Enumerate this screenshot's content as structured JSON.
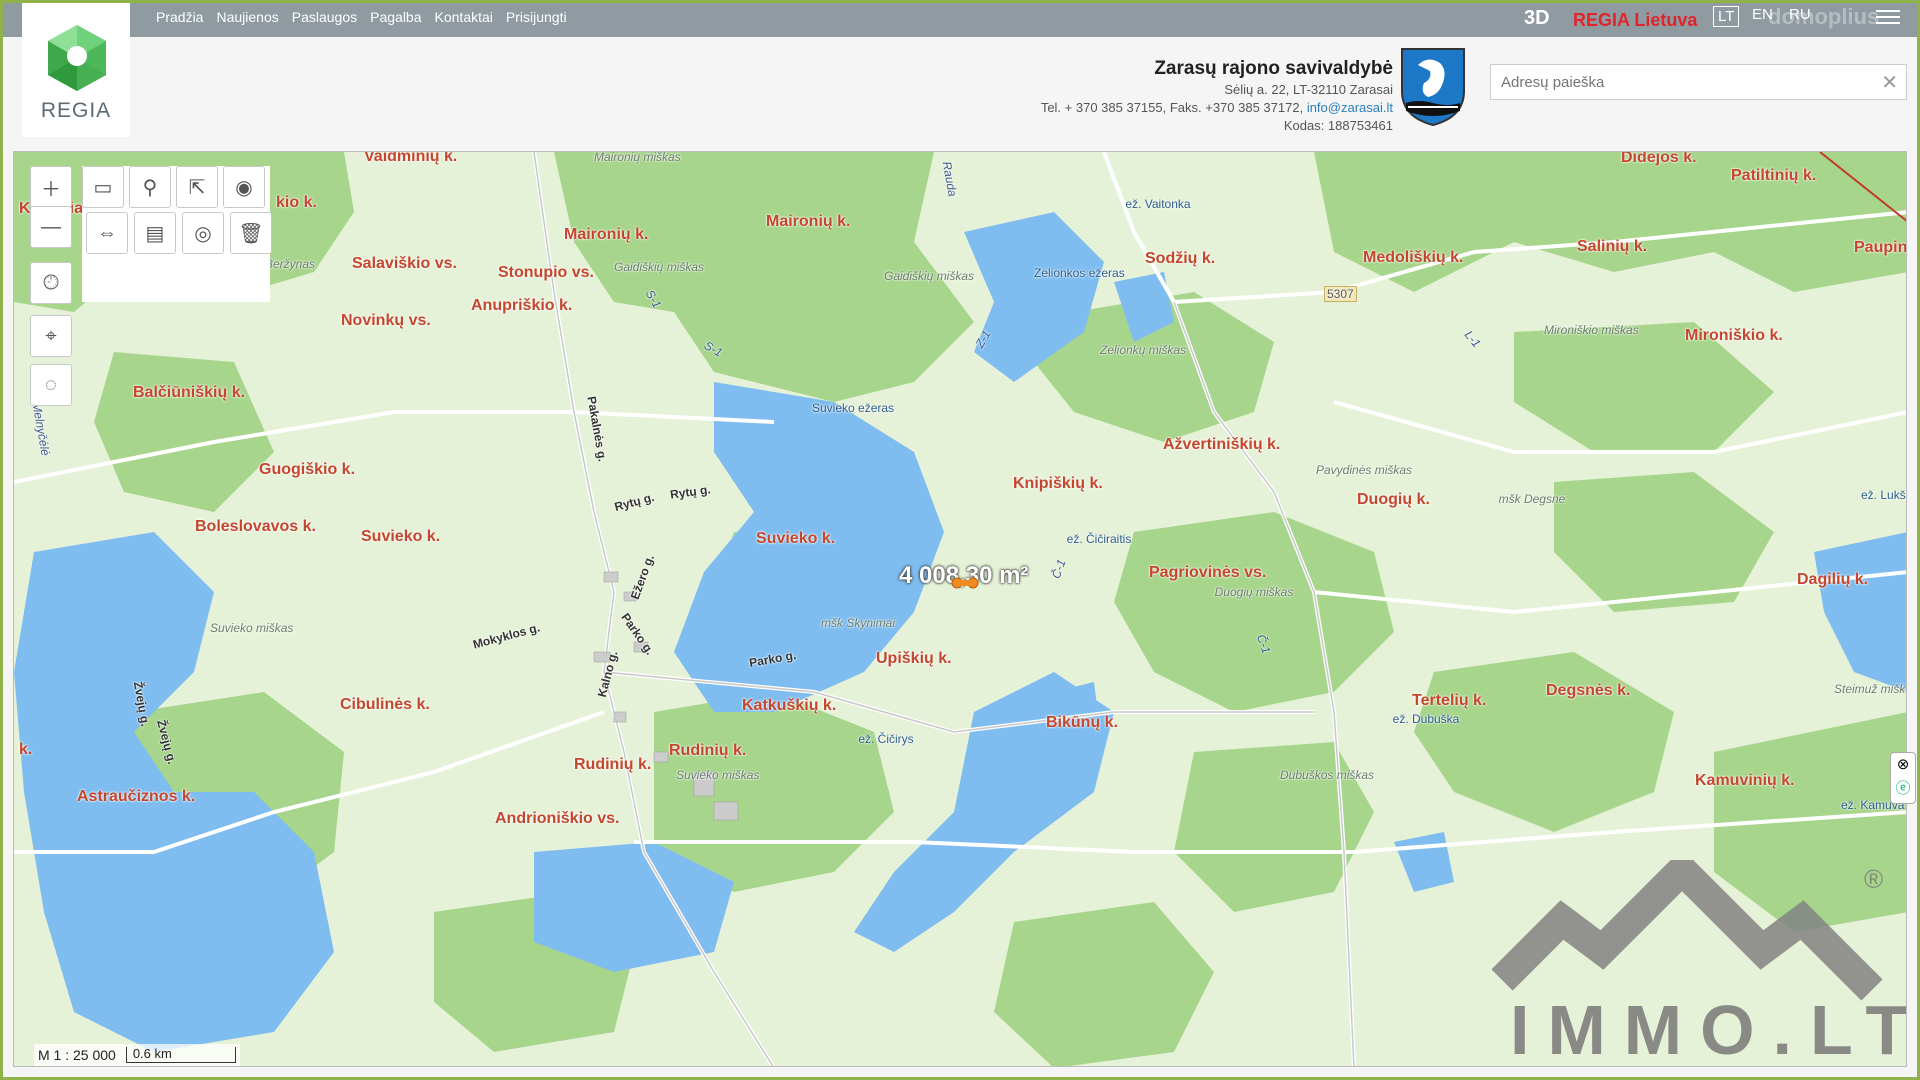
{
  "nav": {
    "items": [
      "Pradžia",
      "Naujienos",
      "Paslaugos",
      "Pagalba",
      "Kontaktai",
      "Prisijungti"
    ],
    "btn_3d": "3D",
    "regia_lietuva": "REGIA Lietuva",
    "lang_lt": "LT",
    "lang_en": "EN",
    "lang_ru": "RU",
    "watermark": "domoplius"
  },
  "logo": {
    "text": "REGIA"
  },
  "org": {
    "name": "Zarasų rajono savivaldybė",
    "address": "Sėlių a. 22, LT-32110 Zarasai",
    "phone": "Tel. + 370 385 37155, Faks. +370 385 37172, ",
    "email": "info@zarasai.lt",
    "code": "Kodas: 188753461"
  },
  "search": {
    "placeholder": "Adresų paieška"
  },
  "map": {
    "area_measurement": "4 008,30 m²",
    "scale_ratio": "M 1 : 25 000",
    "scale_bar": "0.6 km",
    "villages": [
      "Vaidminių k.",
      "Kroviniai",
      "kio k.",
      "Maironių k.",
      "Maironių k.",
      "Didėjos k.",
      "Patiltinių k.",
      "Salaviškio vs.",
      "Stonupio vs.",
      "Anupriškio k.",
      "Novinkų vs.",
      "Sodžių k.",
      "Medoliškių k.",
      "Salinių k.",
      "Paupin",
      "Mironiškio k.",
      "Balčiūniškių k.",
      "Ažvertiniškių k.",
      "Guogiškio k.",
      "Knipiškių k.",
      "Duogių k.",
      "Boleslovavos k.",
      "Suvieko k.",
      "Suvieko k.",
      "Pagriovinės vs.",
      "Dagilių k.",
      "Upiškių k.",
      "Cibulinės k.",
      "Katkuškių k.",
      "Tertelių k.",
      "Degsnės k.",
      "Bikūnų k.",
      "Rudinių k.",
      "Rudinių k.",
      "Astraučiznos k.",
      "Andrioniškio vs.",
      "Kamuvinių k.",
      "k."
    ],
    "water": [
      "ež. Vaitonka",
      "Zelionkos ežeras",
      "Suvieko ežeras",
      "ež. Čičiraitis",
      "ež. Čičirys",
      "ež. Dubuška",
      "ež. Kamuva",
      "ež. Lukšt"
    ],
    "forests": [
      "Maironių miškas",
      "Gaidiškių miškas",
      "Gaidiškių miškas",
      "Beržynas",
      "Zelionkų miškas",
      "Mironiškio miškas",
      "Pavydinės miškas",
      "mšk Degsnė",
      "Duogių miškas",
      "Suvieko miškas",
      "mšk Skynimai",
      "Suvieko miškas",
      "Dubuškos miškas",
      "Steimuž miškas"
    ],
    "streets": [
      "Rytų g.",
      "Rytų g.",
      "Pakalnės g.",
      "Ežero g.",
      "Mokyklos g.",
      "Parko g.",
      "Parko g.",
      "Kalno g.",
      "Žvejų g.",
      "Žvejų g."
    ],
    "roads": [
      "S-1",
      "S-1",
      "Z-1",
      "L-1",
      "Č-1",
      "Č-1",
      "Rauda",
      "Melnyčėlė",
      "5307"
    ]
  },
  "watermark": {
    "brand": "IMMO.LT",
    "registered": "®"
  },
  "colors": {
    "forest": "#a8d78e",
    "meadow": "#e8f3da",
    "water": "#7fbdf0",
    "label": "#c4462c",
    "topbar": "#8f9aa1"
  }
}
